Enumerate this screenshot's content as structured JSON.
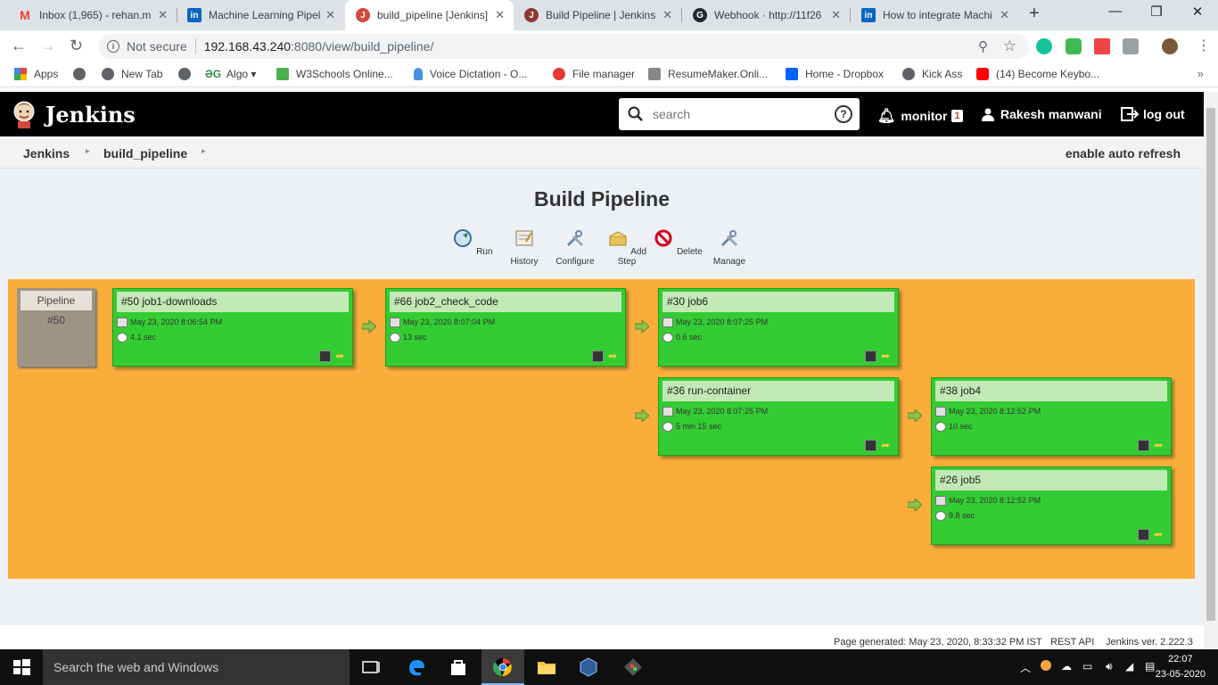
{
  "browser": {
    "tabs": [
      {
        "title": "Inbox (1,965) - rehan.m",
        "favicon": "gmail-icon",
        "color": "#ea4335",
        "letter": "M"
      },
      {
        "title": "Machine Learning Pipel",
        "favicon": "linkedin-icon",
        "color": "#0a66c2",
        "letter": "in"
      },
      {
        "title": "build_pipeline [Jenkins]",
        "favicon": "jenkins-icon",
        "color": "#d24939",
        "letter": "J",
        "active": true
      },
      {
        "title": "Build Pipeline | Jenkins",
        "favicon": "jenkins-icon",
        "color": "#8b3a2f",
        "letter": "J"
      },
      {
        "title": "Webhook · http://11f26",
        "favicon": "github-icon",
        "color": "#24292e",
        "letter": "G"
      },
      {
        "title": "How to integrate Machi",
        "favicon": "linkedin-icon",
        "color": "#0a66c2",
        "letter": "in"
      }
    ],
    "security": "Not secure",
    "url_host": "192.168.43.240",
    "url_rest": ":8080/view/build_pipeline/",
    "bookmarks": [
      {
        "label": "Apps"
      },
      {
        "label": ""
      },
      {
        "label": "New Tab"
      },
      {
        "label": ""
      },
      {
        "label": "Algo ▾"
      },
      {
        "label": "W3Schools Online..."
      },
      {
        "label": "Voice Dictation - O..."
      },
      {
        "label": "File manager"
      },
      {
        "label": "ResumeMaker.Onli..."
      },
      {
        "label": "Home - Dropbox"
      },
      {
        "label": "Kick Ass"
      },
      {
        "label": "(14) Become Keybo..."
      }
    ]
  },
  "jenkins": {
    "brand": "Jenkins",
    "search_placeholder": "search",
    "monitor_label": "monitor",
    "monitor_count": "1",
    "user_name": "Rakesh manwani",
    "logout_label": "log out",
    "breadcrumb": [
      "Jenkins",
      "build_pipeline"
    ],
    "auto_refresh": "enable auto refresh",
    "page_title": "Build Pipeline",
    "actions": [
      "Run",
      "History",
      "Configure",
      "Add Step",
      "Delete",
      "Manage"
    ],
    "pipeline": {
      "label": "Pipeline",
      "number": "#50"
    },
    "jobs": [
      {
        "name": "#50 job1-downloads",
        "date": "May 23, 2020 8:06:54 PM",
        "duration": "4.1 sec"
      },
      {
        "name": "#66 job2_check_code",
        "date": "May 23, 2020 8:07:04 PM",
        "duration": "13 sec"
      },
      {
        "name": "#30 job6",
        "date": "May 23, 2020 8:07:25 PM",
        "duration": "0.6 sec"
      },
      {
        "name": "#36 run-container",
        "date": "May 23, 2020 8:07:25 PM",
        "duration": "5 min 15 sec"
      },
      {
        "name": "#38 job4",
        "date": "May 23, 2020 8:12:52 PM",
        "duration": "10 sec"
      },
      {
        "name": "#26 job5",
        "date": "May 23, 2020 8:12:52 PM",
        "duration": "9.8 sec"
      }
    ],
    "footer": {
      "generated": "Page generated: May 23, 2020, 8:33:32 PM IST",
      "rest_api": "REST API",
      "version": "Jenkins ver. 2.222.3"
    },
    "colors": {
      "success": "#33cc33",
      "board": "#fbad3b",
      "header": "#000000"
    }
  },
  "taskbar": {
    "search_placeholder": "Search the web and Windows",
    "time": "22:07",
    "date": "23-05-2020"
  }
}
